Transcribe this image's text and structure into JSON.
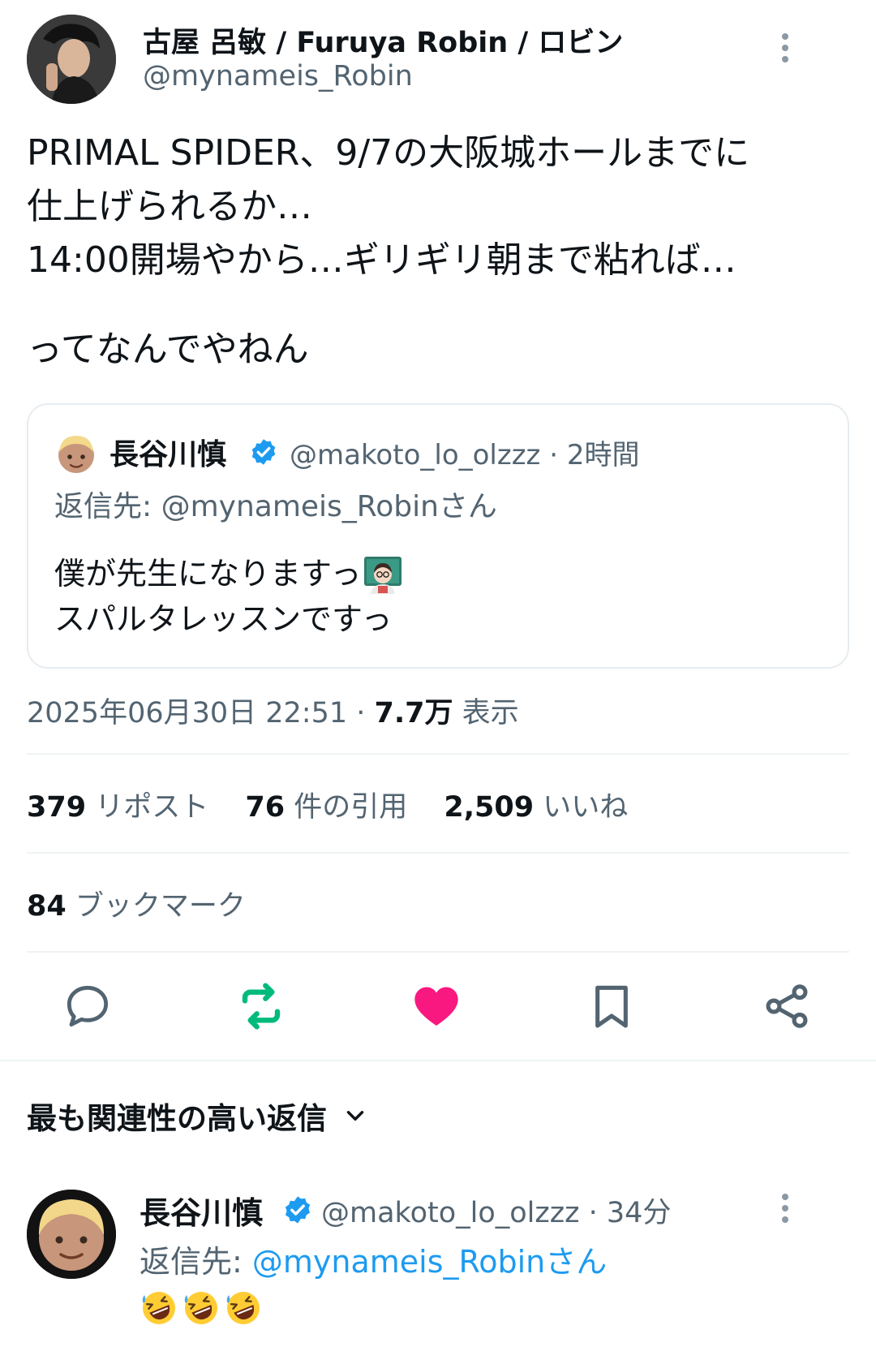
{
  "tweet": {
    "author": {
      "name": "古屋 呂敏 / Furuya Robin / ロビン",
      "handle": "@mynameis_Robin"
    },
    "text_lines": [
      "PRIMAL SPIDER、9/7の大阪城ホールまでに",
      "仕上げられるか…",
      "14:00開場やから…ギリギリ朝まで粘れば…",
      "",
      "ってなんでやねん"
    ],
    "quoted": {
      "author_name": "長谷川慎",
      "handle_time": "@makoto_lo_olzzz · 2時間",
      "reply_to": "返信先: @mynameis_Robinさん",
      "text_line1": "僕が先生になりますっ",
      "text_line2": "スパルタレッスンですっ"
    },
    "timestamp": "2025年06月30日 22:51 · ",
    "views": "7.7万",
    "views_label": " 表示",
    "stats": {
      "reposts": "379",
      "reposts_label": " リポスト",
      "quotes": "76",
      "quotes_label": " 件の引用",
      "likes": "2,509",
      "likes_label": " いいね",
      "bookmarks": "84",
      "bookmarks_label": " ブックマーク"
    },
    "actions": [
      "reply-icon",
      "retweet-icon",
      "like-icon",
      "bookmark-icon",
      "share-icon"
    ]
  },
  "replies_section": {
    "sort_label": "最も関連性の高い返信"
  },
  "reply": {
    "author_name": "長谷川慎",
    "handle_time": "@makoto_lo_olzzz · 34分",
    "reply_to_prefix": "返信先: ",
    "reply_to_handle": "@mynameis_Robinさん"
  },
  "colors": {
    "text": "#0f1419",
    "secondary": "#536471",
    "link": "#1d9bf0",
    "retweet_active": "#00ba7c",
    "like_active": "#f91880",
    "divider": "#eff3f4"
  }
}
